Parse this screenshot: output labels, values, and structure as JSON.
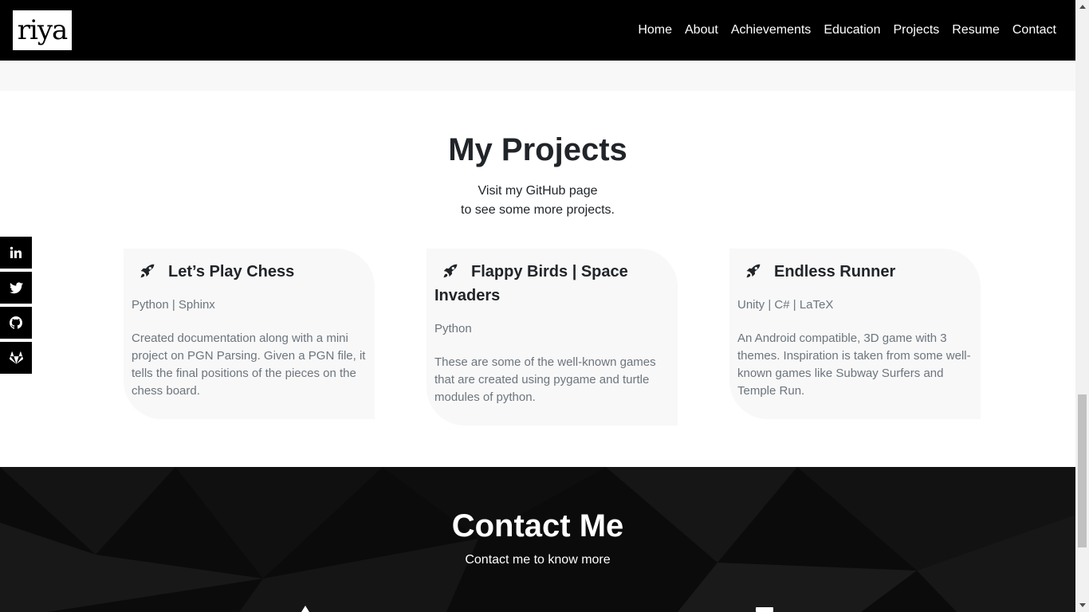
{
  "brand": {
    "logo_text": "riya"
  },
  "nav": {
    "items": [
      {
        "label": "Home"
      },
      {
        "label": "About"
      },
      {
        "label": "Achievements"
      },
      {
        "label": "Education"
      },
      {
        "label": "Projects"
      },
      {
        "label": "Resume"
      },
      {
        "label": "Contact"
      }
    ]
  },
  "social": {
    "items": [
      {
        "icon": "linkedin-icon"
      },
      {
        "icon": "twitter-icon"
      },
      {
        "icon": "github-icon"
      },
      {
        "icon": "gitlab-icon"
      }
    ]
  },
  "projects": {
    "title": "My Projects",
    "subtitle_line1": "Visit my GitHub page",
    "subtitle_line2": "to see some more projects.",
    "cards": [
      {
        "icon": "rocket-icon",
        "title": "Let’s Play Chess",
        "tech": "Python | Sphinx",
        "description": "Created documentation along with a mini project on PGN Parsing. Given a PGN file, it tells the final positions of the pieces on the chess board."
      },
      {
        "icon": "rocket-icon",
        "title": "Flappy Birds | Space Invaders",
        "tech": "Python",
        "description": "These are some of the well-known games that are created using pygame and turtle modules of python."
      },
      {
        "icon": "rocket-icon",
        "title": "Endless Runner",
        "tech": "Unity | C# | LaTeX",
        "description": "An Android compatible, 3D game with 3 themes. Inspiration is taken from some well-known games like Subway Surfers and Temple Run."
      }
    ]
  },
  "contact": {
    "title": "Contact Me",
    "subtitle": "Contact me to know more"
  },
  "colors": {
    "navbar_bg": "#000000",
    "card_bg": "#f8f8f8",
    "muted_text": "#6c757d",
    "contact_bg": "#0b0b0b"
  }
}
